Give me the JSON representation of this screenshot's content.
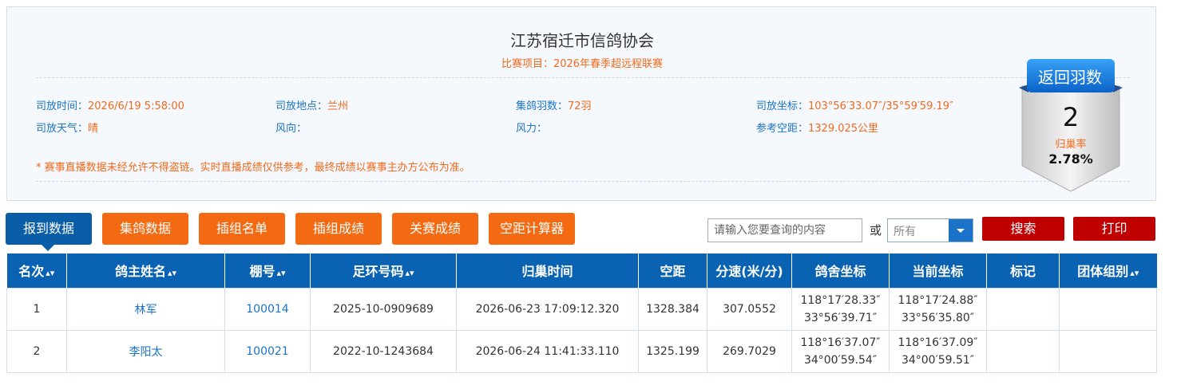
{
  "header": {
    "title": "江苏宿迁市信鸽协会",
    "subtitle": "比赛项目：2026年春季超远程联赛"
  },
  "info": {
    "release_time_label": "司放时间：",
    "release_time": "2026/6/19 5:58:00",
    "release_place_label": "司放地点：",
    "release_place": "兰州",
    "pigeon_count_label": "集鸽羽数：",
    "pigeon_count": "72羽",
    "release_coord_label": "司放坐标：",
    "release_coord": "103°56′33.07″/35°59′59.19″",
    "weather_label": "司放天气：",
    "weather": "晴",
    "wind_dir_label": "风向：",
    "wind_dir": "",
    "wind_force_label": "风力：",
    "wind_force": "",
    "ref_distance_label": "参考空距：",
    "ref_distance": "1329.025公里",
    "notice": "* 赛事直播数据未经允许不得盗链。实时直播成绩仅供参考，最终成绩以赛事主办方公布为准。"
  },
  "badge": {
    "label": "返回羽数",
    "count": "2",
    "rate_label": "归巢率",
    "rate": "2.78%"
  },
  "tabs": [
    "报到数据",
    "集鸽数据",
    "插组名单",
    "插组成绩",
    "关赛成绩",
    "空距计算器"
  ],
  "search": {
    "placeholder": "请输入您要查询的内容",
    "or_label": "或",
    "select_value": "所有",
    "search_label": "搜索",
    "print_label": "打印"
  },
  "table": {
    "columns": [
      "名次",
      "鸽主姓名",
      "棚号",
      "足环号码",
      "归巢时间",
      "空距",
      "分速(米/分)",
      "鸽舍坐标",
      "当前坐标",
      "标记",
      "团体组别"
    ],
    "sort_icon": "sort-arrows-icon",
    "rows": [
      {
        "rank": "1",
        "name": "林军",
        "loft": "100014",
        "ring": "2025-10-0909689",
        "time": "2026-06-23 17:09:12.320",
        "distance": "1328.384",
        "speed": "307.0552",
        "loft_coord_1": "118°17′28.33″",
        "loft_coord_2": "33°56′39.71″",
        "cur_coord_1": "118°17′24.88″",
        "cur_coord_2": "33°56′35.80″",
        "mark": "",
        "group": ""
      },
      {
        "rank": "2",
        "name": "李阳太",
        "loft": "100021",
        "ring": "2022-10-1243684",
        "time": "2026-06-24 11:41:33.110",
        "distance": "1325.199",
        "speed": "269.7029",
        "loft_coord_1": "118°16′37.07″",
        "loft_coord_2": "34°00′59.54″",
        "cur_coord_1": "118°16′37.09″",
        "cur_coord_2": "34°00′59.51″",
        "mark": "",
        "group": ""
      }
    ]
  },
  "colors": {
    "primary_blue": "#0a62b2",
    "tab_orange": "#f36a12",
    "button_red": "#c00000",
    "value_orange": "#f06a1c"
  }
}
